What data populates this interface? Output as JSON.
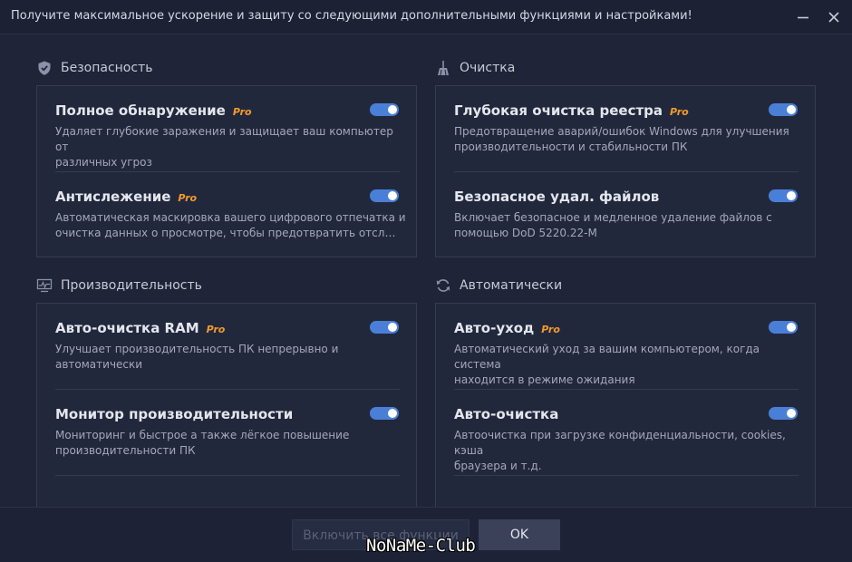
{
  "window": {
    "title": "Получите максимальное ускорение и защиту со следующими дополнительными функциями и настройками!"
  },
  "sections": [
    {
      "title": "Безопасность",
      "icon": "shield-icon",
      "items": [
        {
          "name": "Полное обнаружение",
          "pro": "Pro",
          "enabled": true,
          "desc1": "Удаляет глубокие заражения и защищает ваш компьютер от",
          "desc2": "различных угроз"
        },
        {
          "name": "Антислежение",
          "pro": "Pro",
          "enabled": true,
          "desc1": "Автоматическая маскировка вашего цифрового отпечатка и",
          "desc2": "очистка данных о просмотре, чтобы предотвратить отслеживание"
        }
      ]
    },
    {
      "title": "Очистка",
      "icon": "broom-icon",
      "items": [
        {
          "name": "Глубокая очистка реестра",
          "pro": "Pro",
          "enabled": true,
          "desc1": "Предотвращение аварий/ошибок  Windows  для улучшения",
          "desc2": "производительности и стабильности ПК"
        },
        {
          "name": "Безопасное удал. файлов",
          "pro": "",
          "enabled": true,
          "desc1": "Включает безопасное и медленное удаление файлов с",
          "desc2": "помощью DoD 5220.22-M"
        }
      ]
    },
    {
      "title": "Производительность",
      "icon": "monitor-chart-icon",
      "items": [
        {
          "name": "Авто-очистка RAM",
          "pro": "Pro",
          "enabled": true,
          "desc1": "Улучшает производительность ПК непрерывно и",
          "desc2": "автоматически"
        },
        {
          "name": "Монитор производительности",
          "pro": "",
          "enabled": true,
          "desc1": "Мониторинг и быстрое а также лёгкое повышение",
          "desc2": "производительности ПК"
        }
      ]
    },
    {
      "title": "Автоматически",
      "icon": "refresh-icon",
      "items": [
        {
          "name": "Авто-уход",
          "pro": "Pro",
          "enabled": true,
          "desc1": "Автоматический уход за вашим компьютером, когда система",
          "desc2": "находится в режиме ожидания"
        },
        {
          "name": "Авто-очистка",
          "pro": "",
          "enabled": true,
          "desc1": "Автоочистка при загрузке конфиденциальности, cookies, кэша",
          "desc2": "браузера и т.д."
        }
      ]
    }
  ],
  "footer": {
    "enable_all_label": "Включить все функции",
    "ok_label": "OK"
  },
  "watermark": "NoNaMe-Club",
  "colors": {
    "background": "#1f2438",
    "card": "#22283c",
    "toggle_on": "#4a7fd8",
    "pro_badge": "#f39a2b"
  }
}
